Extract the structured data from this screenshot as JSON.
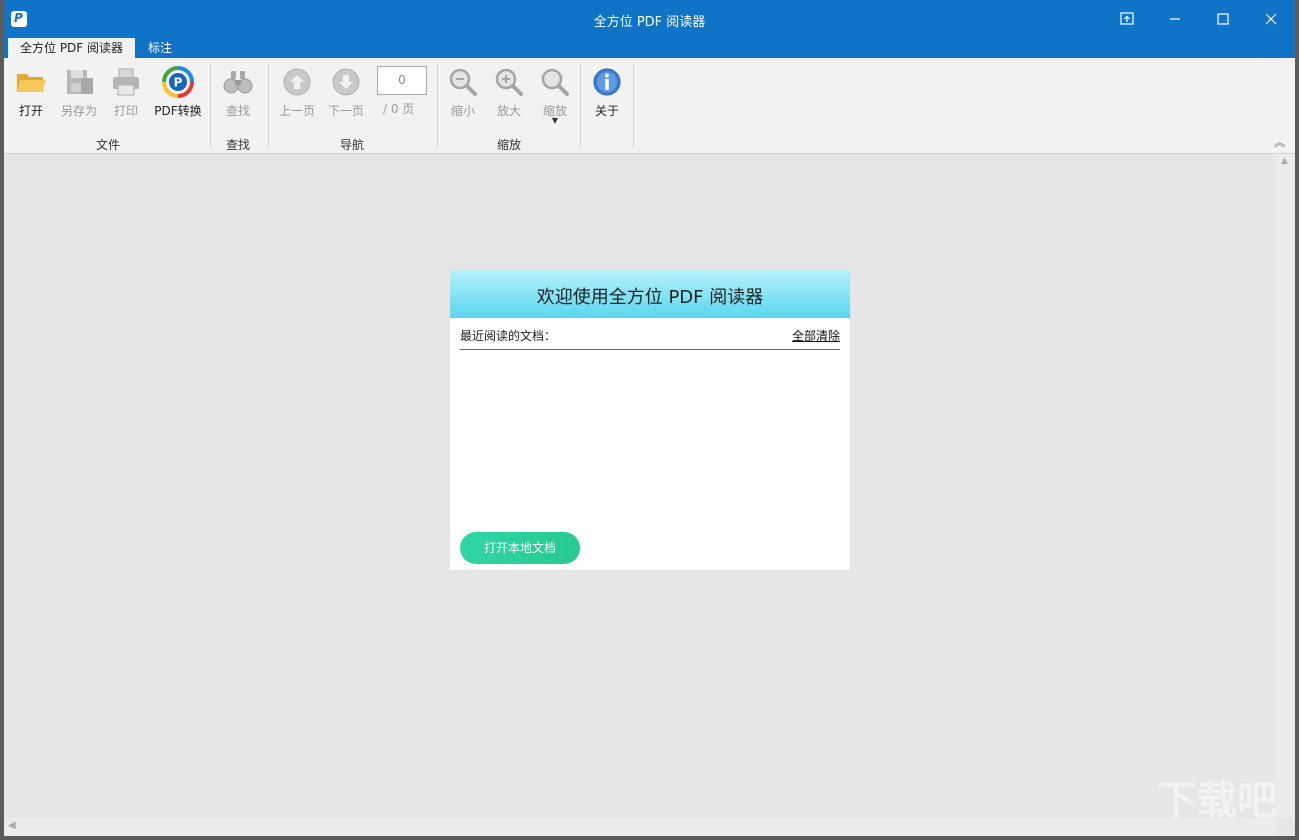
{
  "window": {
    "title": "全方位 PDF 阅读器"
  },
  "tabs": [
    {
      "label": "全方位 PDF 阅读器"
    },
    {
      "label": "标注"
    }
  ],
  "ribbon": {
    "file": {
      "group_label": "文件",
      "open": "打开",
      "save_as": "另存为",
      "print": "打印",
      "pdf_convert": "PDF转换"
    },
    "find": {
      "group_label": "查找",
      "find": "查找"
    },
    "navigation": {
      "group_label": "导航",
      "prev_page": "上一页",
      "next_page": "下一页",
      "page_value": "0",
      "page_total": "/ 0 页"
    },
    "zoom": {
      "group_label": "缩放",
      "zoom_out": "缩小",
      "zoom_in": "放大",
      "zoom": "缩放"
    },
    "about": {
      "about": "关于"
    }
  },
  "welcome": {
    "title": "欢迎使用全方位 PDF 阅读器",
    "recent_label": "最近阅读的文档：",
    "clear_all": "全部清除",
    "open_local": "打开本地文档"
  },
  "watermark": "下载吧",
  "colors": {
    "titlebar": "#0f73c8",
    "panel_header": "#5ad6ef",
    "open_button": "#2fd6a6"
  }
}
